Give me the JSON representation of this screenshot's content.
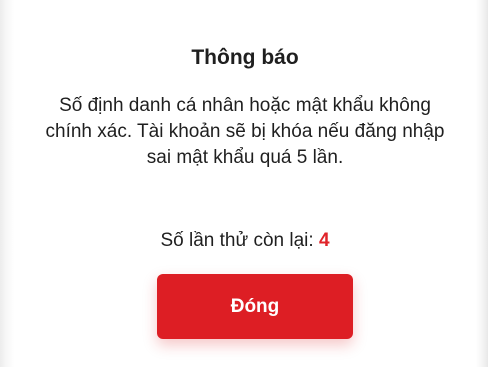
{
  "dialog": {
    "title": "Thông báo",
    "message": "Số định danh cá nhân hoặc mật khẩu không chính xác. Tài khoản sẽ bị khóa nếu đăng nhập sai mật khẩu quá 5 lần.",
    "attempts_label": "Số lần thử còn lại:",
    "attempts_remaining": "4",
    "close_label": "Đóng"
  },
  "colors": {
    "accent": "#dd1e24",
    "attempts_count": "#e0242a",
    "text": "#1f1f1f",
    "background": "#ffffff"
  }
}
